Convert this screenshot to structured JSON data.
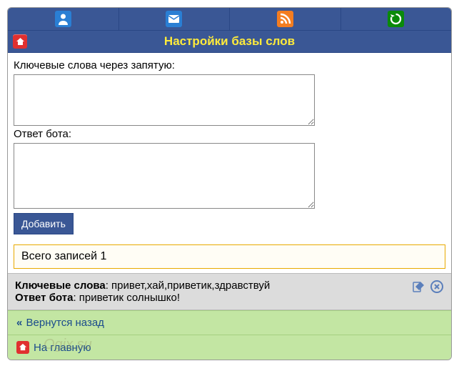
{
  "header": {
    "title": "Настройки базы слов"
  },
  "form": {
    "keywords_label": "Ключевые слова через запятую:",
    "keywords_value": "",
    "answer_label": "Ответ бота:",
    "answer_value": "",
    "submit_label": "Добавить"
  },
  "count_text": "Всего записей 1",
  "entry": {
    "keywords_label": "Ключевые слова",
    "keywords_value": ": привет,хай,приветик,здравствуй",
    "answer_label": "Ответ бота",
    "answer_value": ": приветик солнышко!"
  },
  "nav": {
    "back_label": "Вернутся назад",
    "home_label": "На главную"
  },
  "watermark": "Ogix.su"
}
